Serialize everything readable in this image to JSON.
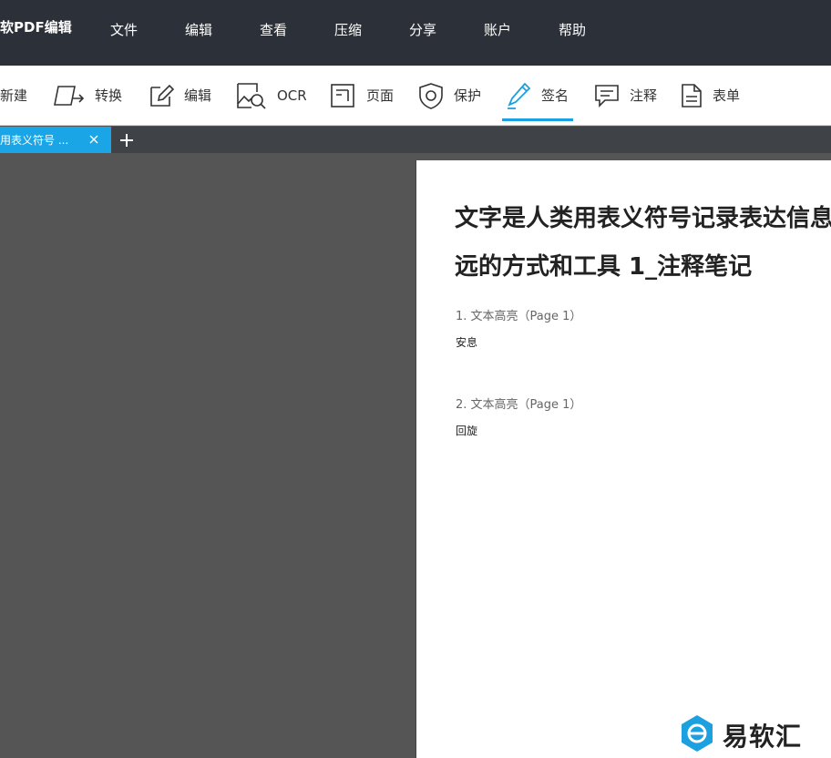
{
  "app": {
    "title": "软PDF编辑"
  },
  "menu": {
    "items": [
      "文件",
      "编辑",
      "查看",
      "压缩",
      "分享",
      "账户",
      "帮助"
    ]
  },
  "toolbar": {
    "items": [
      {
        "label": "新建",
        "icon": "new-icon"
      },
      {
        "label": "转换",
        "icon": "convert-icon"
      },
      {
        "label": "编辑",
        "icon": "edit-icon"
      },
      {
        "label": "OCR",
        "icon": "ocr-icon"
      },
      {
        "label": "页面",
        "icon": "page-icon"
      },
      {
        "label": "保护",
        "icon": "shield-icon"
      },
      {
        "label": "签名",
        "icon": "pen-icon",
        "active": true
      },
      {
        "label": "注释",
        "icon": "comment-icon"
      },
      {
        "label": "表单",
        "icon": "form-icon"
      }
    ],
    "accent": "#1da0e0"
  },
  "tabs": {
    "items": [
      {
        "label": "用表义符号 ...",
        "active": true
      }
    ]
  },
  "document": {
    "title_line1": "文字是人类用表义符号记录表达信息",
    "title_line2": "远的方式和工具 1_注释笔记",
    "notes": [
      {
        "heading": "1. 文本高亮（Page 1）",
        "text": "安息"
      },
      {
        "heading": "2. 文本高亮（Page 1）",
        "text": "回旋"
      }
    ]
  },
  "watermark": {
    "text": "易软汇",
    "icon": "logo-icon",
    "color": "#1da0e0"
  }
}
